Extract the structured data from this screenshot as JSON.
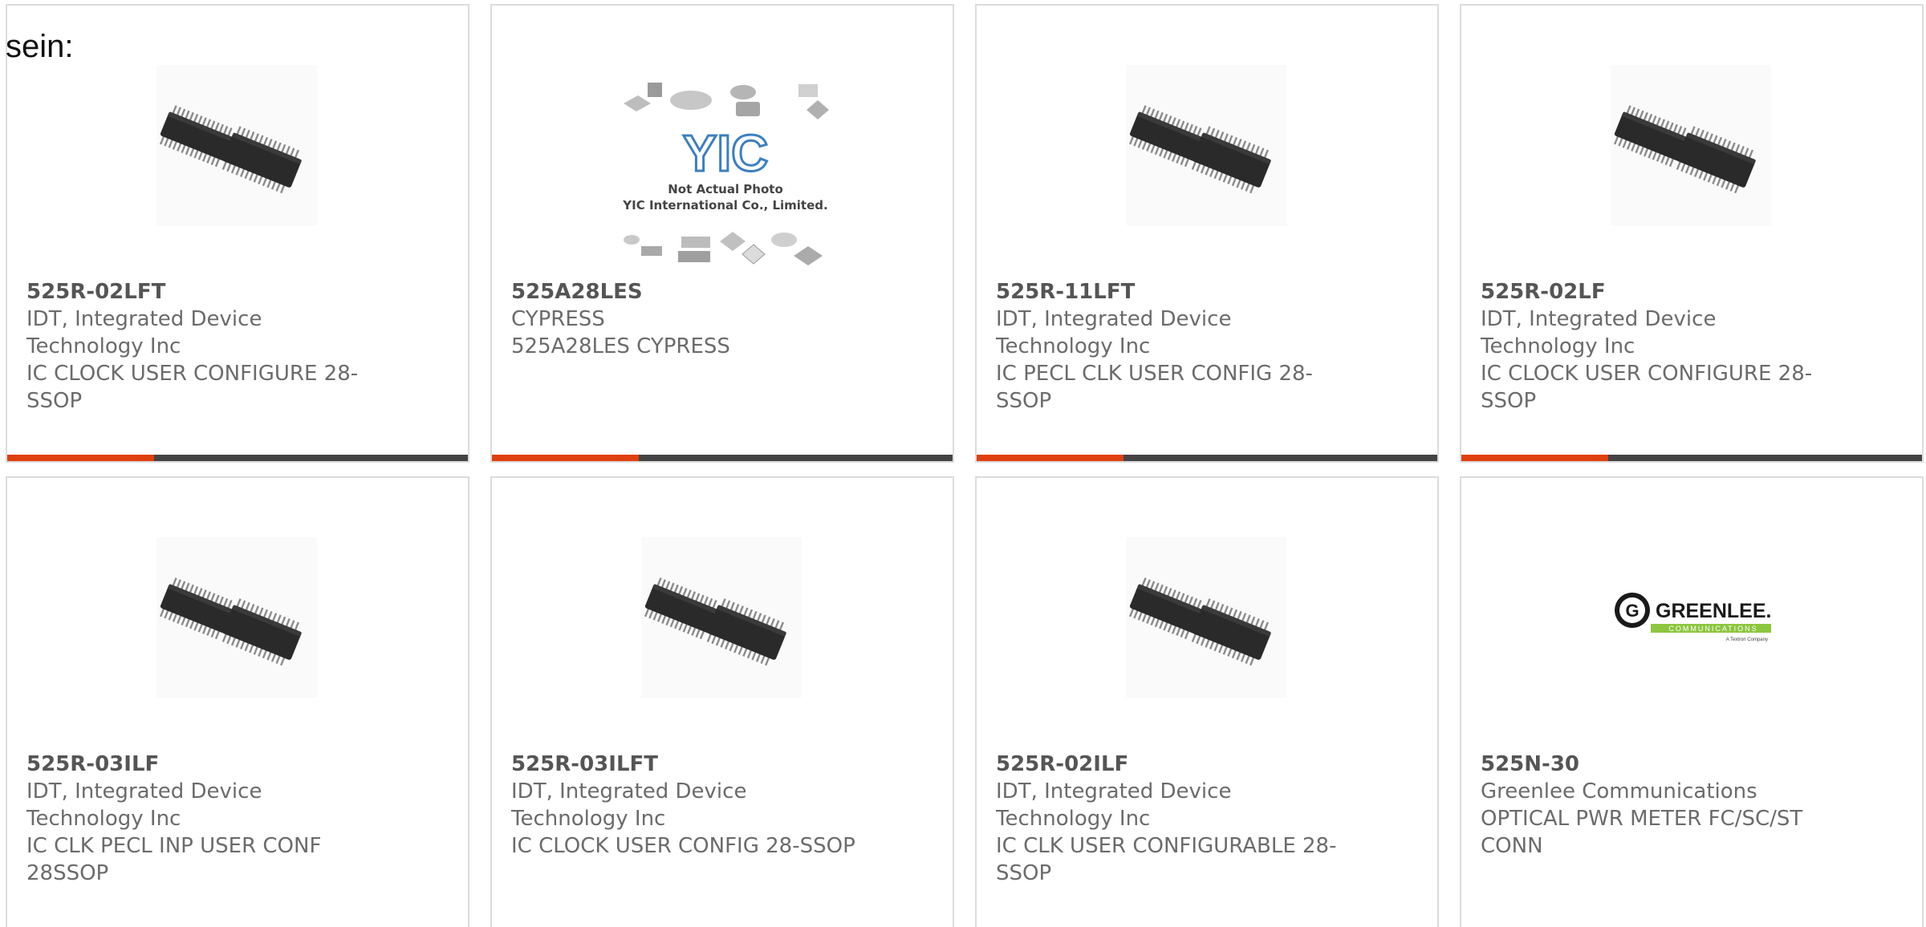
{
  "intro_text": "sein:",
  "colors": {
    "accent": "#e0400e",
    "bar": "#444444",
    "border": "#dcdcdc"
  },
  "products": [
    {
      "part": "525R-02LFT",
      "lines": [
        "IDT, Integrated Device",
        "Technology Inc",
        "IC CLOCK USER CONFIGURE 28-",
        "SSOP"
      ],
      "image": "ic-chip-ssop"
    },
    {
      "part": "525A28LES",
      "lines": [
        "CYPRESS",
        "525A28LES CYPRESS"
      ],
      "image": "yic-placeholder",
      "placeholder_text": [
        "Not Actual Photo",
        "YIC International Co., Limited."
      ],
      "placeholder_logo": "YIC"
    },
    {
      "part": "525R-11LFT",
      "lines": [
        "IDT, Integrated Device",
        "Technology Inc",
        "IC PECL CLK USER CONFIG 28-",
        "SSOP"
      ],
      "image": "ic-chip-ssop"
    },
    {
      "part": "525R-02LF",
      "lines": [
        "IDT, Integrated Device",
        "Technology Inc",
        "IC CLOCK USER CONFIGURE 28-",
        "SSOP"
      ],
      "image": "ic-chip-ssop"
    },
    {
      "part": "525R-03ILF",
      "lines": [
        "IDT, Integrated Device",
        "Technology Inc",
        "IC CLK PECL INP USER CONF",
        "28SSOP"
      ],
      "image": "ic-chip-ssop"
    },
    {
      "part": "525R-03ILFT",
      "lines": [
        "IDT, Integrated Device",
        "Technology Inc",
        "IC CLOCK USER CONFIG 28-SSOP"
      ],
      "image": "ic-chip-ssop"
    },
    {
      "part": "525R-02ILF",
      "lines": [
        "IDT, Integrated Device",
        "Technology Inc",
        "IC CLK USER CONFIGURABLE 28-",
        "SSOP"
      ],
      "image": "ic-chip-ssop"
    },
    {
      "part": "525N-30",
      "lines": [
        "Greenlee Communications",
        "OPTICAL PWR METER FC/SC/ST",
        "CONN"
      ],
      "image": "greenlee-logo",
      "logo_text": [
        "GREENLEE.",
        "COMMUNICATIONS",
        "A Textron Company"
      ]
    }
  ]
}
